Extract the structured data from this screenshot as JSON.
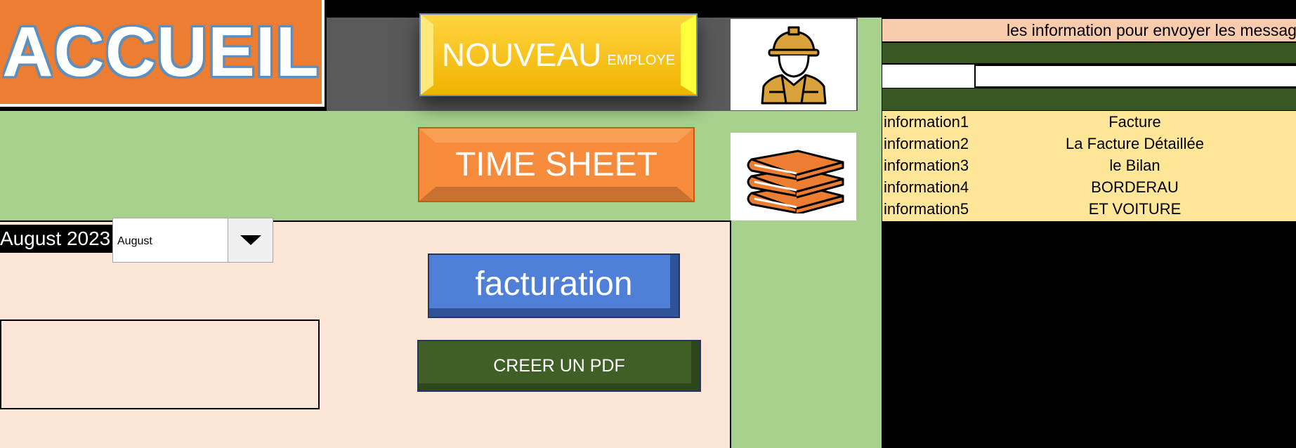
{
  "header": {
    "title": "ACCUEIL"
  },
  "buttons": {
    "nouveau_main": "NOUVEAU",
    "nouveau_sub": "EMPLOYE",
    "timesheet": "TIME SHEET",
    "facturation": "facturation",
    "pdf": "CREER UN PDF"
  },
  "icons": {
    "worker": "construction-worker-icon",
    "books": "books-icon"
  },
  "month": {
    "display": "August  2023",
    "selected": "August"
  },
  "info_panel": {
    "title": "les information pour envoyer les messages",
    "rows": [
      {
        "key": "information1",
        "value": "Facture"
      },
      {
        "key": "information2",
        "value": "La Facture Détaillée"
      },
      {
        "key": "information3",
        "value": "le Bilan"
      },
      {
        "key": "information4",
        "value": "BORDERAU"
      },
      {
        "key": "information5",
        "value": "ET VOITURE"
      }
    ]
  },
  "colors": {
    "accent_orange": "#ed7d31",
    "green_light": "#a9d18e",
    "green_dark": "#375623",
    "pink_bg": "#fce4d6",
    "info_yellow": "#ffe699"
  }
}
